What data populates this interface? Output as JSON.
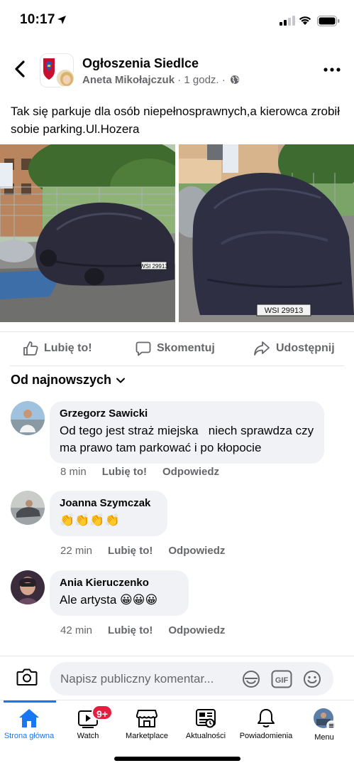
{
  "status_bar": {
    "time": "10:17"
  },
  "post": {
    "group_name": "Ogłoszenia Siedlce",
    "author": "Aneta Mikołajczuk",
    "time_ago": "1 godz.",
    "meta_separator": "·",
    "text": "Tak się parkuje dla osób niepełnosprawnych,a kierowca zrobił sobie parking.Ul.Hozera",
    "plate_1": "WSI 29913",
    "plate_2": "WSI 29913"
  },
  "actions": {
    "like": "Lubię to!",
    "comment": "Skomentuj",
    "share": "Udostępnij"
  },
  "sort": {
    "label": "Od najnowszych"
  },
  "comments": [
    {
      "name": "Grzegorz Sawicki",
      "text": "Od tego jest straż miejska   niech sprawdza czy ma prawo tam parkować i po kłopocie",
      "time": "8 min",
      "like": "Lubię to!",
      "reply": "Odpowiedz"
    },
    {
      "name": "Joanna Szymczak",
      "text": "👏👏👏👏",
      "time": "22 min",
      "like": "Lubię to!",
      "reply": "Odpowiedz"
    },
    {
      "name": "Ania Kieruczenko",
      "text": "Ale artysta 😀😀😀",
      "time": "42 min",
      "like": "Lubię to!",
      "reply": "Odpowiedz"
    }
  ],
  "compose": {
    "placeholder": "Napisz publiczny komentar...",
    "gif_label": "GIF"
  },
  "tabbar": {
    "tabs": [
      {
        "label": "Strona główna",
        "icon": "home-icon",
        "active": true
      },
      {
        "label": "Watch",
        "icon": "watch-icon",
        "badge": "9+"
      },
      {
        "label": "Marketplace",
        "icon": "marketplace-icon"
      },
      {
        "label": "Aktualności",
        "icon": "news-icon"
      },
      {
        "label": "Powiadomienia",
        "icon": "bell-icon"
      },
      {
        "label": "Menu",
        "icon": "menu-avatar-icon"
      }
    ]
  },
  "colors": {
    "accent": "#1877f2",
    "badge": "#e41e3f",
    "bubble": "#f0f2f5",
    "secondary_text": "#65676b"
  }
}
